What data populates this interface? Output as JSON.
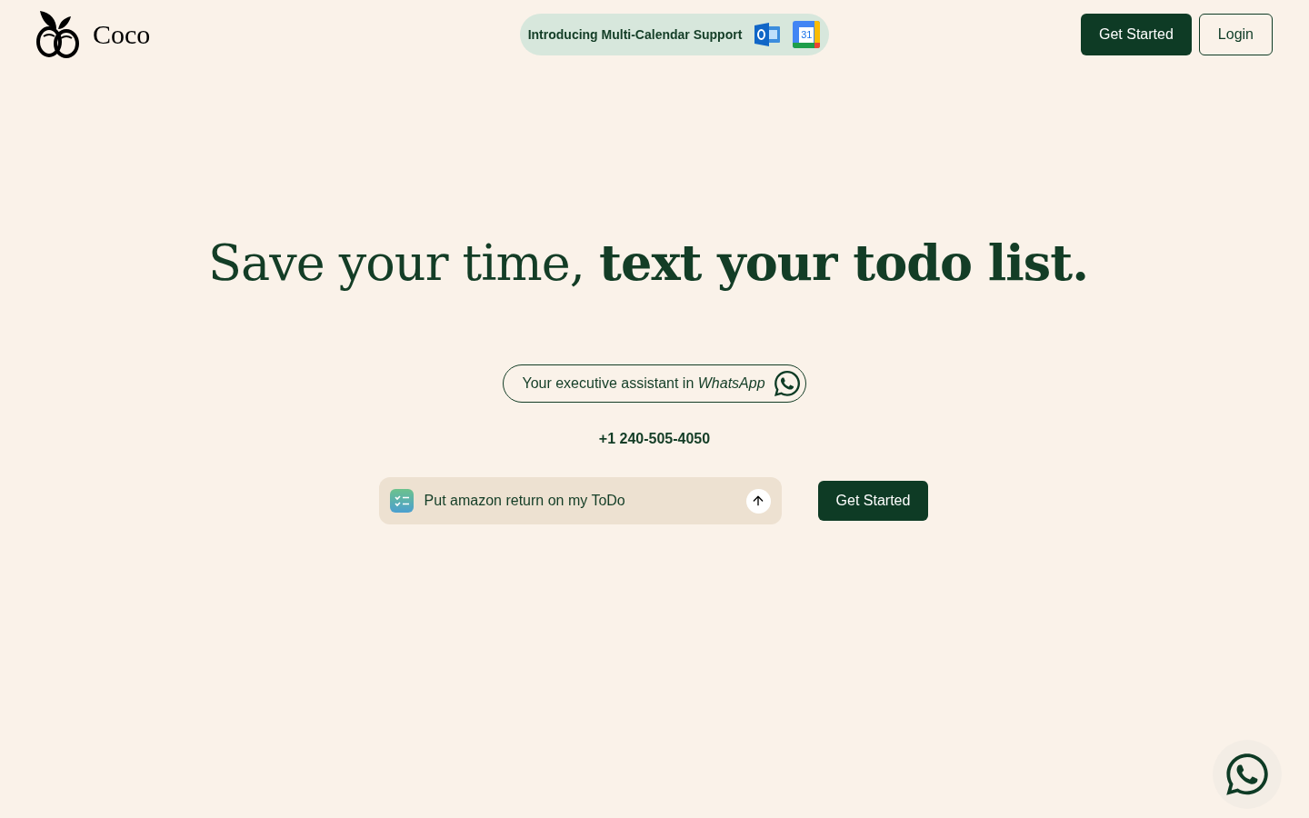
{
  "logo": {
    "name": "Coco"
  },
  "announcement": {
    "text": "Introducing Multi-Calendar Support",
    "calendar_day": "31"
  },
  "nav_buttons": [
    {
      "label": "Get Started",
      "kind": "primary"
    },
    {
      "label": "Login",
      "kind": "outline"
    }
  ],
  "hero": {
    "headline": "Save your time, **text your todo list.**",
    "tagline": "Your executive assistant in *WhatsApp*",
    "phone": "+1 240-505-4050"
  },
  "prompt": {
    "value": "Put amazon return on my ToDo"
  },
  "cta": {
    "label": "Get Started"
  }
}
